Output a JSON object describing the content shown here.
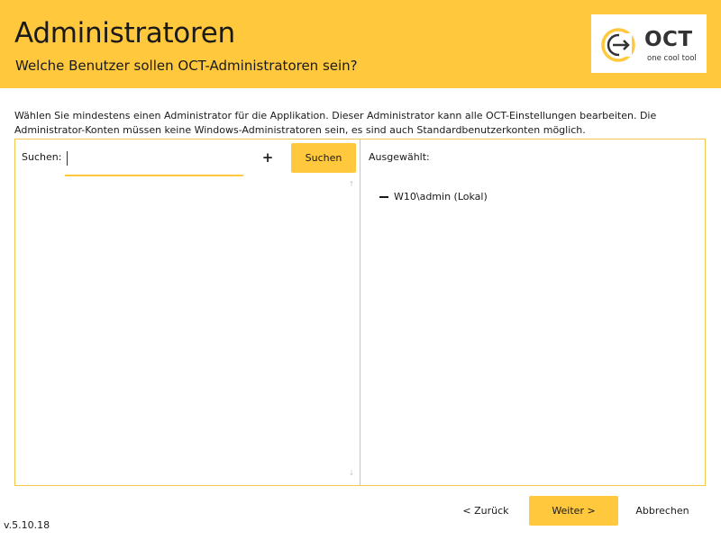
{
  "header": {
    "title": "Administratoren",
    "subtitle": "Welche Benutzer sollen OCT-Administratoren sein?"
  },
  "logo": {
    "name": "OCT",
    "tagline": "one cool tool",
    "icon": "oct-logo-icon"
  },
  "description": "Wählen Sie mindestens einen Administrator für die Applikation. Dieser Administrator kann alle OCT-Einstellungen bearbeiten. Die Administrator-Konten müssen keine Windows-Administratoren sein, es sind auch Standardbenutzerkonten möglich.",
  "search": {
    "label": "Suchen:",
    "value": "",
    "placeholder": "",
    "add_symbol": "+",
    "button_label": "Suchen",
    "results": []
  },
  "selected": {
    "label": "Ausgewählt:",
    "items": [
      {
        "name": "W10\\admin (Lokal)"
      }
    ]
  },
  "footer": {
    "back_label": "< Zurück",
    "next_label": "Weiter >",
    "cancel_label": "Abbrechen",
    "version": "v.5.10.18"
  },
  "colors": {
    "accent": "#ffc83d",
    "border": "#f0c64c",
    "text": "#1a1a1a"
  }
}
